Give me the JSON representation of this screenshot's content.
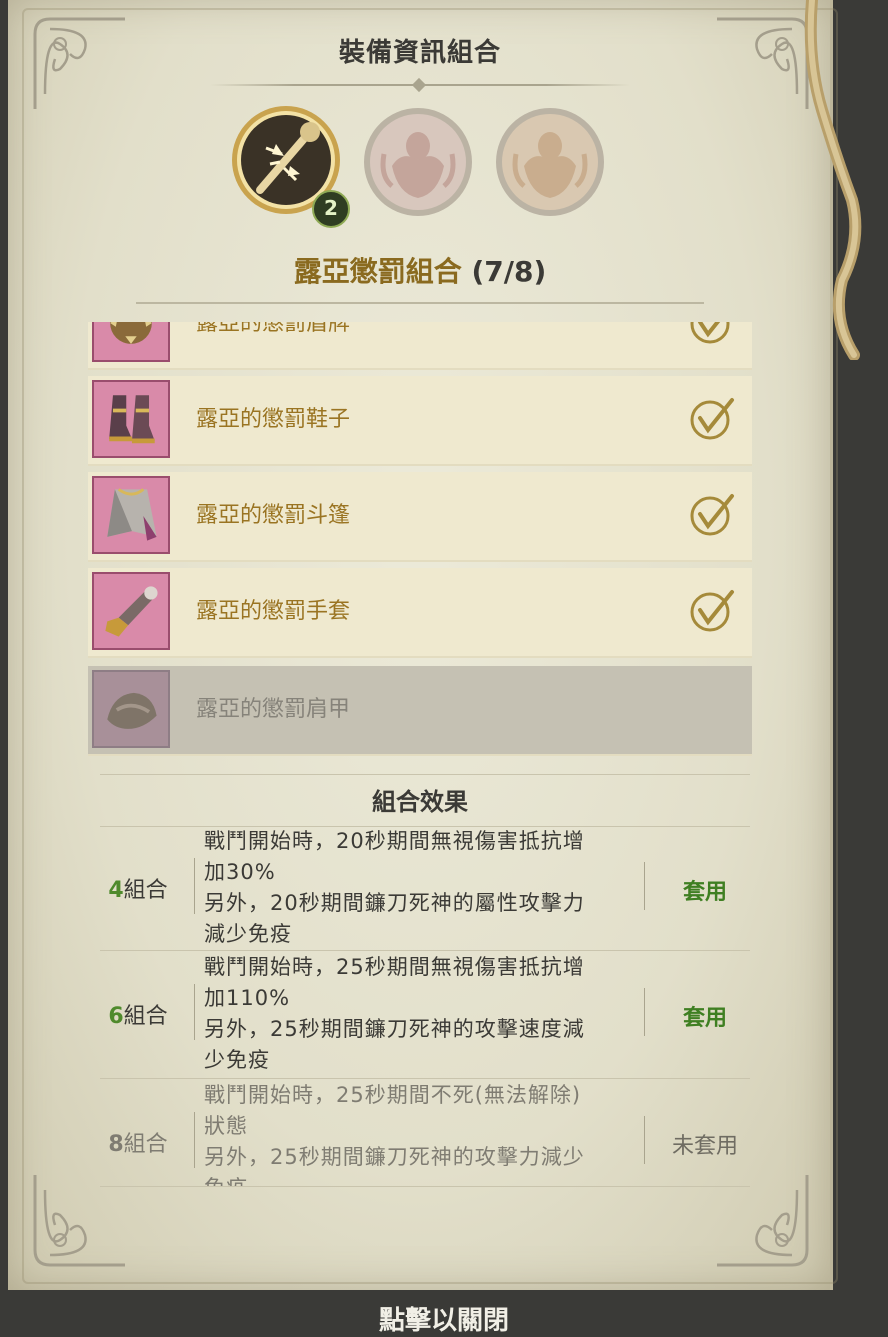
{
  "panel_title": "裝備資訊組合",
  "set_icons": [
    {
      "name": "weapon-set-icon",
      "badge": "2",
      "active": true
    },
    {
      "name": "reaper-set-icon",
      "active": false
    },
    {
      "name": "reaper-set-icon-2",
      "active": false
    }
  ],
  "set_name": "露亞懲罰組合",
  "set_count": "(7/8)",
  "items": [
    {
      "label": "露亞的懲罰盾牌",
      "equipped": true
    },
    {
      "label": "露亞的懲罰鞋子",
      "equipped": true
    },
    {
      "label": "露亞的懲罰斗篷",
      "equipped": true
    },
    {
      "label": "露亞的懲罰手套",
      "equipped": true
    },
    {
      "label": "露亞的懲罰肩甲",
      "equipped": false
    }
  ],
  "effects_title": "組合效果",
  "effects": [
    {
      "num": "4",
      "unit": "組合",
      "lines": [
        "戰鬥開始時，20秒期間無視傷害抵抗增",
        "加30%",
        "另外，20秒期間鐮刀死神的屬性攻擊力",
        "減少免疫"
      ],
      "status": "套用",
      "active": true
    },
    {
      "num": "6",
      "unit": "組合",
      "lines": [
        "戰鬥開始時，25秒期間無視傷害抵抗增",
        "加110%",
        "另外，25秒期間鐮刀死神的攻擊速度減",
        "少免疫"
      ],
      "status": "套用",
      "active": true
    },
    {
      "num": "8",
      "unit": "組合",
      "lines": [
        "戰鬥開始時，25秒期間不死(無法解除)",
        "狀態",
        "另外，25秒期間鐮刀死神的攻擊力減少",
        "免疫"
      ],
      "status": "未套用",
      "active": false
    }
  ],
  "close_hint": "點擊以關閉"
}
